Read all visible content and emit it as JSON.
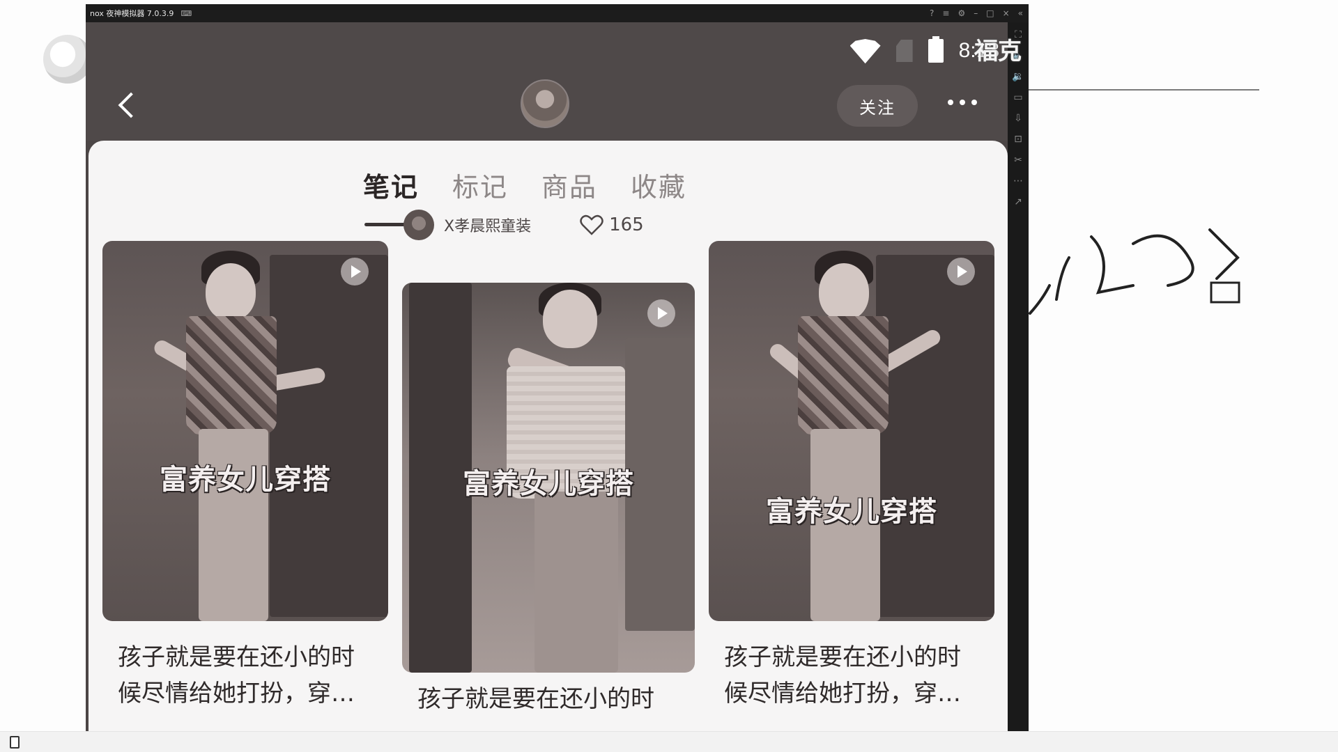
{
  "emulator": {
    "title": "nox 夜神模拟器 7.0.3.9"
  },
  "status_bar": {
    "time": "8:13"
  },
  "header": {
    "follow_label": "关注"
  },
  "tabs": [
    {
      "label": "笔记"
    },
    {
      "label": "标记"
    },
    {
      "label": "商品"
    },
    {
      "label": "收藏"
    }
  ],
  "notes": [
    {
      "overlay": "富养女儿穿搭",
      "title_line1": "孩子就是要在还小的时",
      "title_line2": "候尽情给她打扮，穿…"
    },
    {
      "overlay": "富养女儿穿搭",
      "title_line1": "孩子就是要在还小的时",
      "author": "X孝晨熙童装",
      "likes": "165"
    },
    {
      "overlay": "富养女儿穿搭",
      "title_line1": "孩子就是要在还小的时",
      "title_line2": "候尽情给她打扮，穿…"
    }
  ],
  "whiteboard": {
    "overlay_text": "福克"
  },
  "colors": {
    "header_bg": "#4f4949",
    "sheet_bg": "#f6f5f5",
    "text_dark": "#2b2626"
  }
}
